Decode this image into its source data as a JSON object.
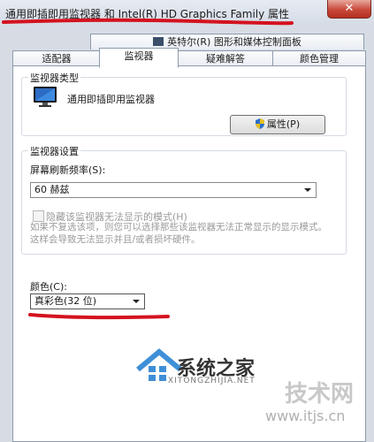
{
  "window": {
    "title": "通用即插即用监视器 和 Intel(R) HD Graphics Family 属性",
    "close_label": "✕"
  },
  "tabs": {
    "intel": "英特尔(R) 图形和媒体控制面板",
    "adapter": "适配器",
    "monitor": "监视器",
    "troubleshoot": "疑难解答",
    "color_mgmt": "颜色管理"
  },
  "monitor_type": {
    "label": "监视器类型",
    "name": "通用即插即用监视器",
    "properties_button": "属性(P)"
  },
  "monitor_settings": {
    "label": "监视器设置",
    "refresh_label": "屏幕刷新频率(S):",
    "refresh_value": "60 赫兹",
    "hide_modes_label": "隐藏该监视器无法显示的模式(H)",
    "note": "如果不复选该项，则您可以选择那些该监视器无法正常显示的显示模式。这样会导致无法显示并且/或者损坏硬件。"
  },
  "color": {
    "label": "颜色(C):",
    "value": "真彩色(32 位)"
  },
  "watermark": {
    "brand": "系统之家",
    "sub": "XITONGZHIJIA.NET",
    "site": "技术网",
    "url": "www.itjs.cn"
  },
  "colors": {
    "annotation": "#d4121f",
    "accent": "#2a6fc9"
  },
  "icons": [
    "monitor-icon",
    "shield-icon",
    "chevron-down-icon",
    "close-icon"
  ]
}
